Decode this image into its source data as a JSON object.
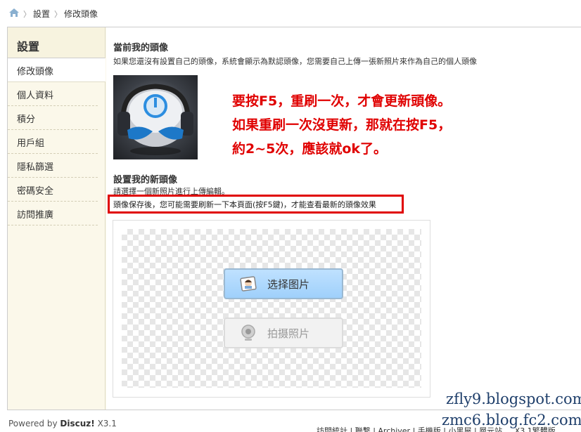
{
  "breadcrumb": {
    "items": [
      "設置",
      "修改頭像"
    ]
  },
  "sidebar": {
    "title": "設置",
    "items": [
      {
        "label": "修改頭像"
      },
      {
        "label": "個人資料"
      },
      {
        "label": "積分"
      },
      {
        "label": "用戶組"
      },
      {
        "label": "隱私篩選"
      },
      {
        "label": "密碼安全"
      },
      {
        "label": "訪問推廣"
      }
    ]
  },
  "main": {
    "current_title": "當前我的頭像",
    "current_desc": "如果您還沒有設置自己的頭像，系統會顯示為默認頭像，您需要自己上傳一張新照片來作為自己的個人頭像",
    "new_title": "設置我的新頭像",
    "new_desc": "請選擇一個新照片進行上傳編輯。",
    "new_warning": "頭像保存後，您可能需要刷新一下本頁面(按F5鍵)，才能查看最新的頭像效果",
    "pick_button": "选择图片",
    "photo_button": "拍摄照片"
  },
  "annotation": {
    "lines": [
      "要按F5，重刷一次，才會更新頭像。",
      "如果重刷一次沒更新，那就在按F5，",
      "約2~5次，應該就ok了。"
    ]
  },
  "footer": {
    "powered": "Powered by",
    "brand": "Discuz!",
    "version": "X3.1",
    "links": "訪問統計 | 聯繫 | Archiver | 手機版 | 小黑屋 | 層元站 ... X3.1繁體版"
  },
  "watermarks": [
    "zfly9.blogspot.com",
    "zmc6.blog.fc2.com"
  ],
  "colors": {
    "accent_red": "#e00000",
    "sidebar_bg": "#fbf8ea",
    "pick_button_bg": "#a8d6ff"
  }
}
